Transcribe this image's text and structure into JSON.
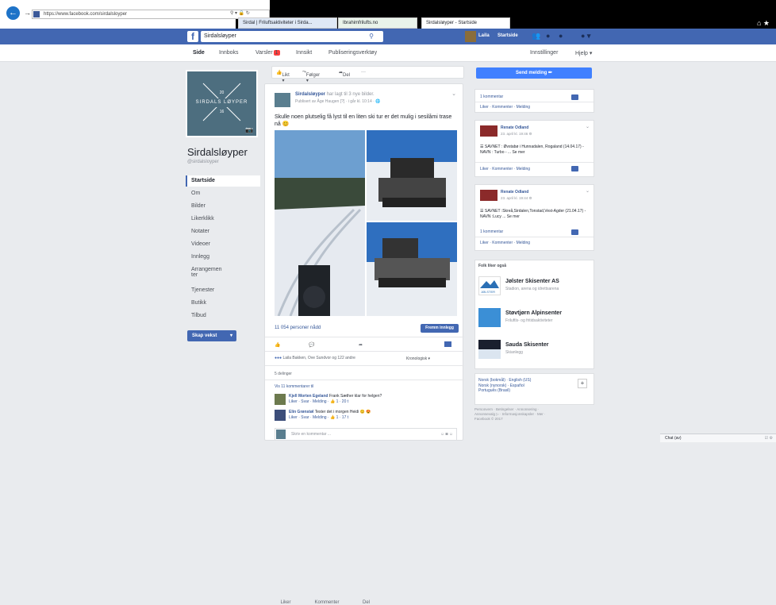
{
  "browser": {
    "address": "https://www.facebook.com/sirdalsloyper",
    "tabs": [
      {
        "label": "Sirdal | Friluftsaktiviteter i Sirda..."
      },
      {
        "label": "Ibrahimfrilufts.no"
      },
      {
        "label": "Sirdalsløyper - Startside"
      }
    ],
    "colors": {
      "accent": "#1e73c8"
    }
  },
  "topbar": {
    "search_value": "Sirdalsløyper",
    "user_name": "Laila",
    "home_label": "Startside",
    "help_icon": "?",
    "brand_color": "#4267b2"
  },
  "pagenav": {
    "items": [
      "Side",
      "Innboks",
      "Varsler",
      "Innsikt",
      "Publiseringsverktøy"
    ],
    "notif_badge": "1",
    "settings": "Innstillinger",
    "help": "Hjelp ▾"
  },
  "page": {
    "cover_text": "SIRDALS LØYPER",
    "cover_year_top": "20",
    "cover_year_bottom": "16",
    "name": "Sirdalsløyper",
    "handle": "@sirdalsloyper",
    "nav": [
      "Startside",
      "Om",
      "Bilder",
      "Likerklikk",
      "Notater",
      "Videoer",
      "Innlegg",
      "Arrangemen ter",
      "Tjenester",
      "Butikk",
      "Tilbud"
    ],
    "shop_button": "Skap vekst"
  },
  "actionbar": {
    "like": "Likt ▾",
    "follow": "Følger ▾",
    "share": "Del",
    "more": "···"
  },
  "post": {
    "author": "Sirdalsløyper",
    "author_suffix": "har lagt til 3 nye bilder.",
    "meta": "Publisert av Åge Haugen [?] · i går kl. 10:14 · 🌐",
    "text": "Skulle noen plutselig få lyst til en liten ski tur er det mulig i sesilåmi trase nå 😊",
    "reach": "11 054 personer nådd",
    "boost": "Fremm innlegg",
    "like": "Liker",
    "comment": "Kommenter",
    "share": "Del",
    "reactions": "Laila Bakken, Ove Sundvor og 122 andre",
    "order": "Kronologisk ▾",
    "shares": "5 delinger",
    "more_comments": "Vis 11 kommentarer til",
    "comments": [
      {
        "name": "Kjell Morten Egeland",
        "text": "Frank Sæther klar for helgen?",
        "links": "Liker · Svar · Melding · 👍 1 · 20 t"
      },
      {
        "name": "Elin Grønstøl",
        "text": "Tester det i morgen Heidi 😊 😍",
        "links": "Liker · Svar · Melding · 👍 1 · 17 t"
      }
    ],
    "write_placeholder": "Skriv en kommentar ..."
  },
  "right": {
    "send_message": "Send melding ✏",
    "top_card": {
      "comments": "1 kommentar",
      "links": "Liker · Kommenter · Melding"
    },
    "posts": [
      {
        "name": "Renate Odland",
        "time": "23. april kl. 19:46 ⚙",
        "body": "☰ SAVNET : Øvstabø i Hunnadalen, Rogaland (14.04.17) - NAVN : Turbo - ... Se mer",
        "links": "Liker · Kommenter · Melding"
      },
      {
        "name": "Renate Odland",
        "time": "23. april kl. 19:44 ⚙",
        "body": "☰ SAVNET :Skreå,Sirdalen,Tonstad,Vest-Agder (21.04.17) - NAVN :Lucy ... Se mer",
        "comments": "1 kommentar",
        "links": "Liker · Kommenter · Melding"
      }
    ],
    "suggest_header": "Folk liker også",
    "suggestions": [
      {
        "name": "Jølster Skisenter AS",
        "cat": "Stadion, arena og idrettsarena"
      },
      {
        "name": "Støvtjørn Alpinsenter",
        "cat": "Friluftls- og fritidsaktiviteter"
      },
      {
        "name": "Sauda Skisenter",
        "cat": "Skianlegg"
      }
    ],
    "lang_line1": "Norsk (bokmål) · English (US)",
    "lang_line2": "Norsk (nynorsk) · Español",
    "lang_line3": "Português (Brasil)",
    "footer1": "Personvern · Betingelser · Annonsering ·",
    "footer2": "Annonsevalg ▷ · Informasjonskapsler · Mer ·",
    "footer3": "Facebook © 2017"
  },
  "chat": {
    "label": "Chat (av)"
  }
}
